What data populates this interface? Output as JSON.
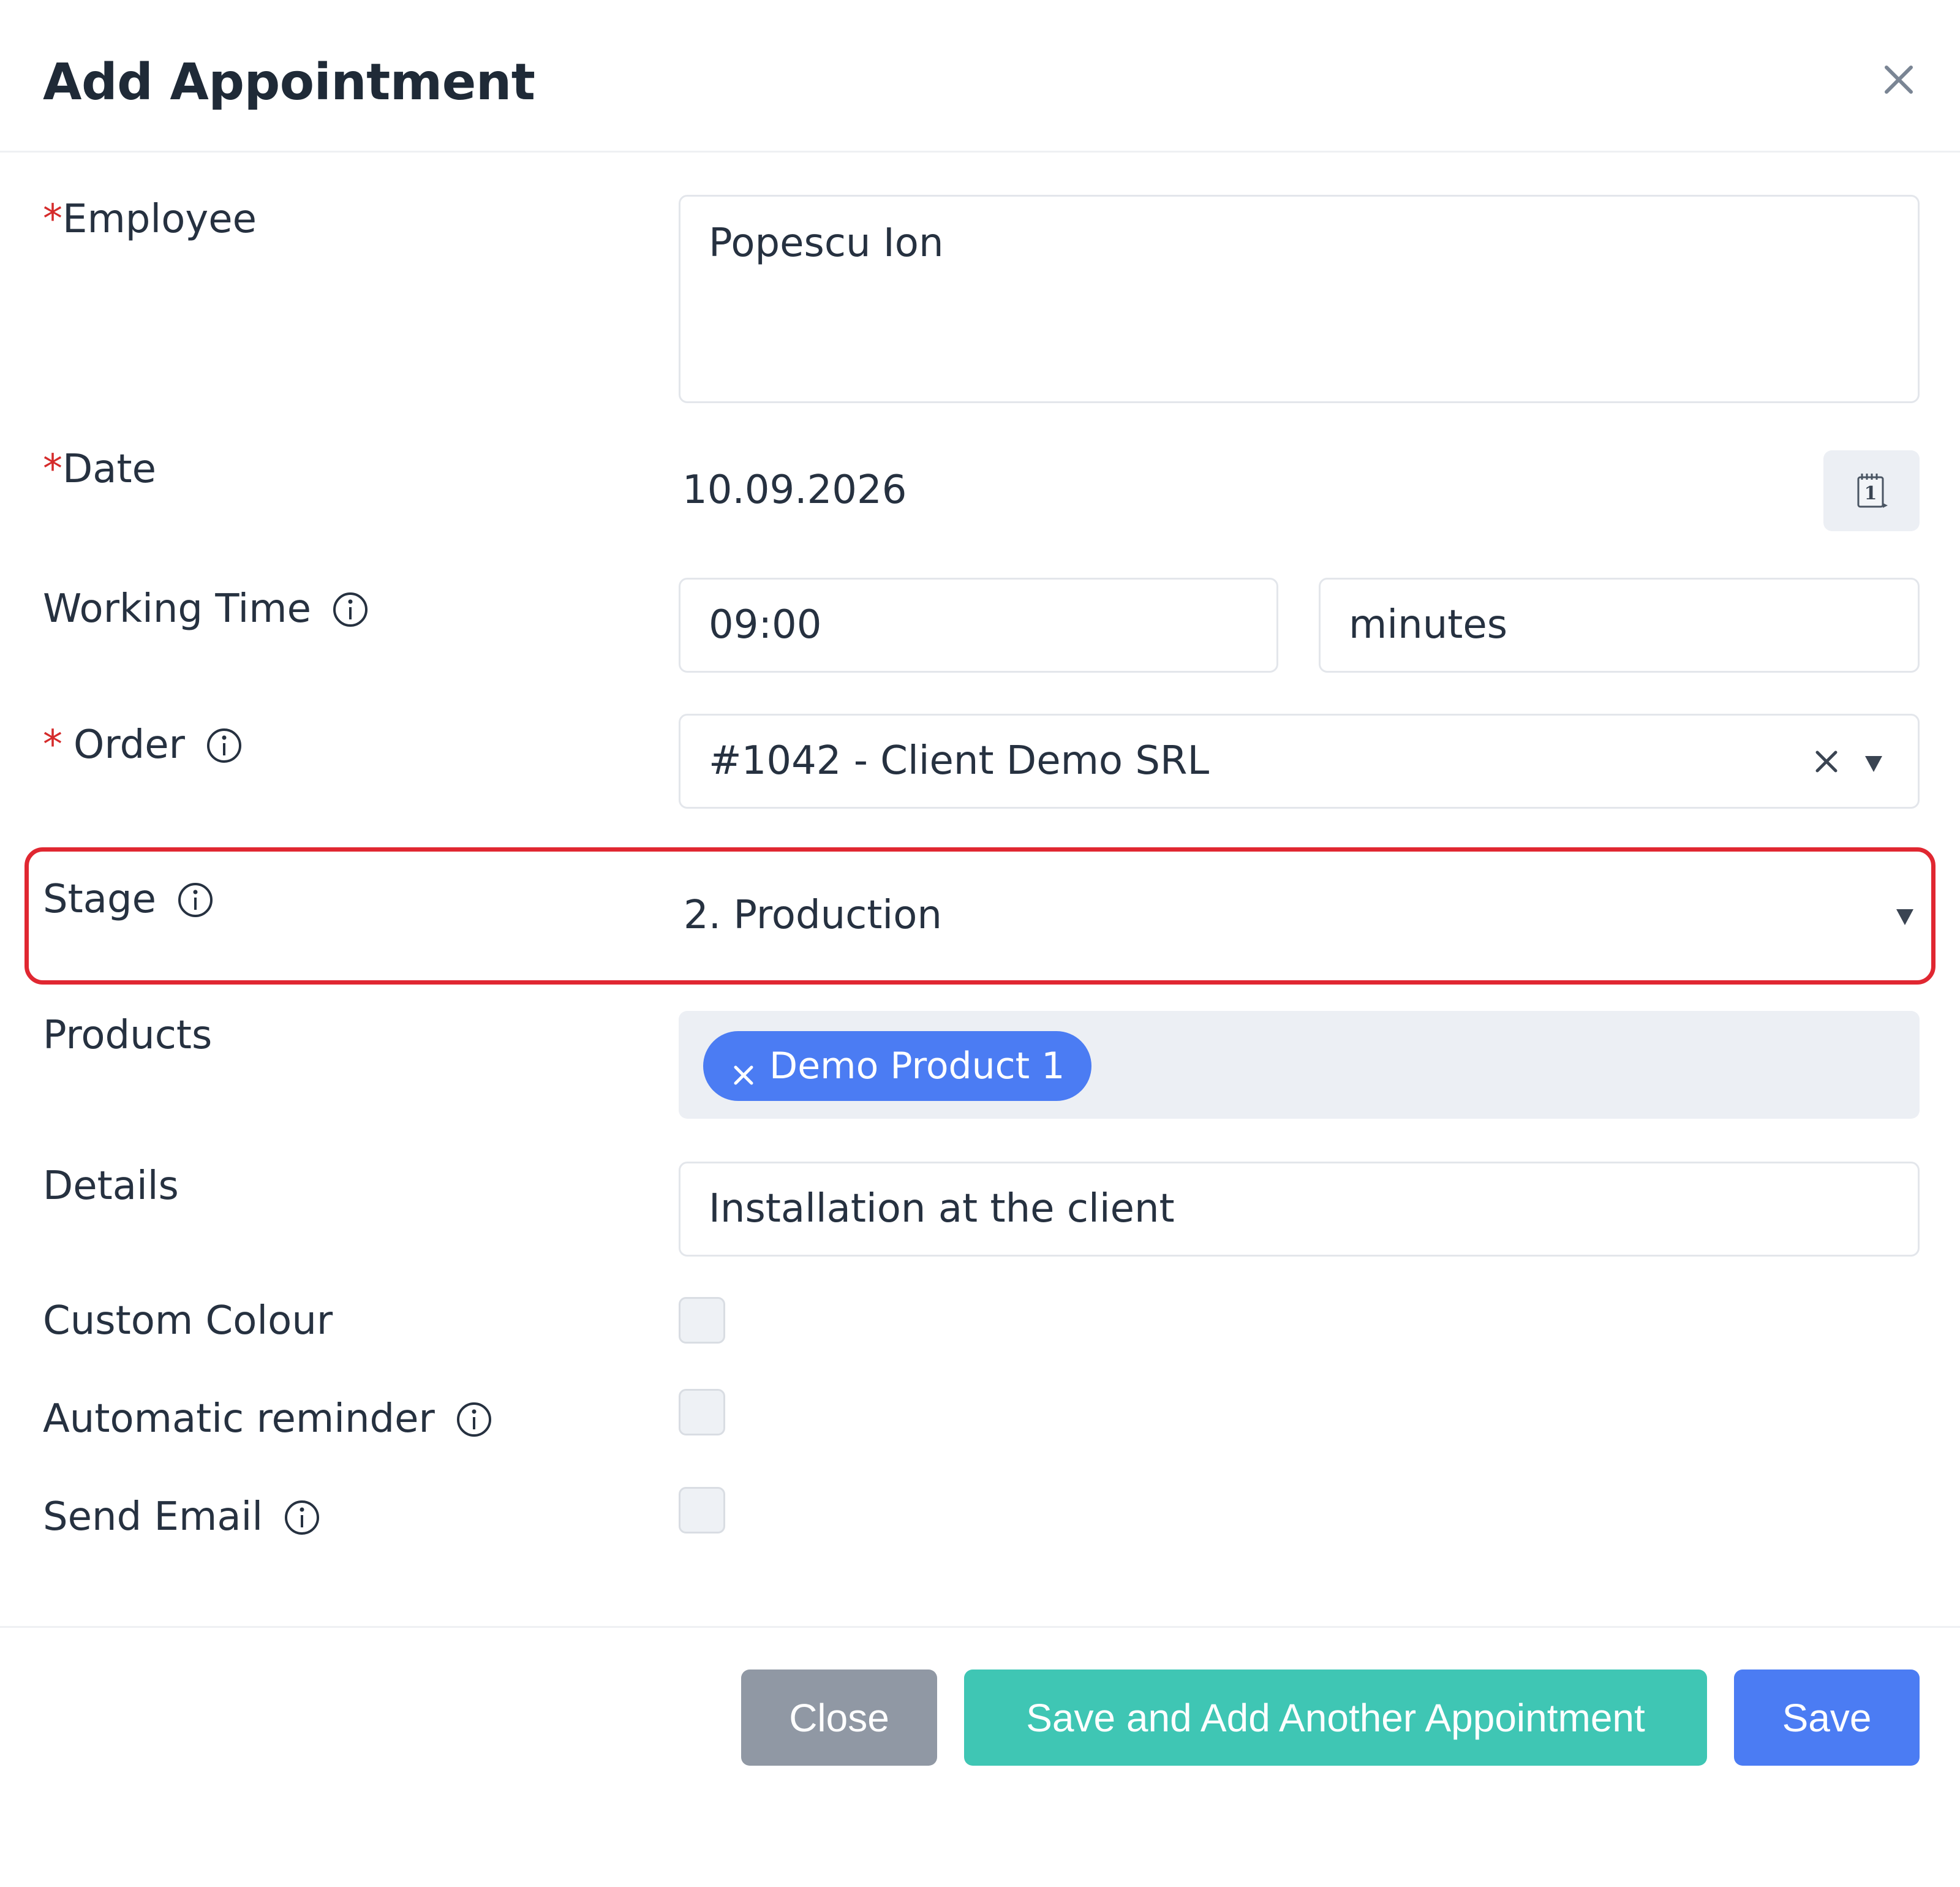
{
  "dialog": {
    "title": "Add Appointment"
  },
  "required_marker": "*",
  "fields": {
    "employee": {
      "label": "Employee",
      "value": "Popescu Ion"
    },
    "date": {
      "label": "Date",
      "value": "10.09.2026"
    },
    "working_time": {
      "label": "Working Time",
      "time_value": "09:00",
      "duration_value": "minutes"
    },
    "order": {
      "label": "Order",
      "value": "#1042 - Client Demo SRL"
    },
    "stage": {
      "label": "Stage",
      "value": "2. Production"
    },
    "products": {
      "label": "Products",
      "chips": [
        "Demo Product 1"
      ]
    },
    "details": {
      "label": "Details",
      "value": "Installation at the client"
    },
    "custom_colour": {
      "label": "Custom Colour",
      "checked": false
    },
    "automatic_reminder": {
      "label": "Automatic reminder",
      "checked": false
    },
    "send_email": {
      "label": "Send Email",
      "checked": false
    }
  },
  "buttons": {
    "close": "Close",
    "save_and_add_another": "Save and Add Another Appointment",
    "save": "Save"
  },
  "icons": {
    "dialog_close": "close-icon",
    "calendar": "calendar-icon",
    "info": "info-icon",
    "clear": "clear-icon",
    "dropdown": "caret-down-icon",
    "chip_remove": "remove-chip-icon"
  },
  "colors": {
    "primary": "#4b7cf3",
    "teal": "#3fc6b4",
    "grey_button": "#9098a4",
    "required": "#d52b2b",
    "highlight": "#e02731"
  }
}
